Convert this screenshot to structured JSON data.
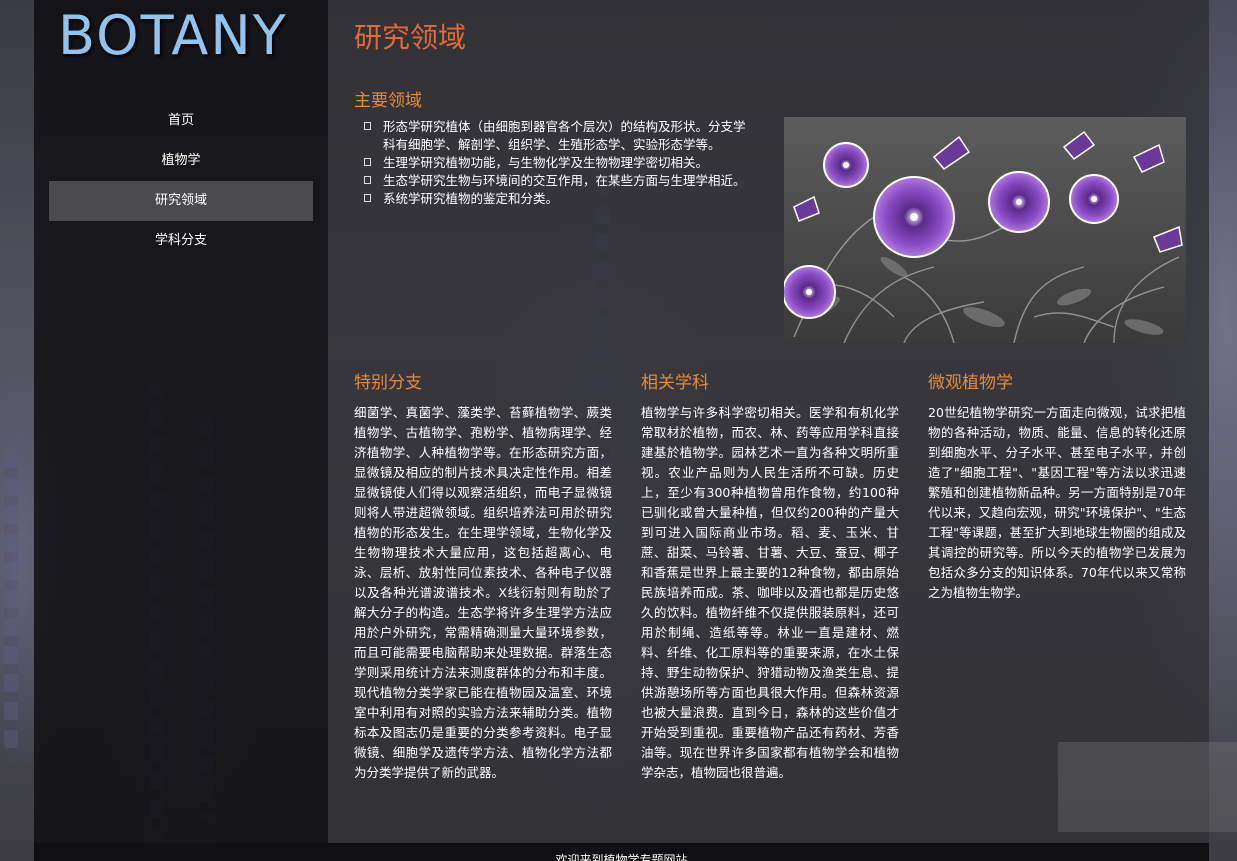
{
  "logo": "BOTANY",
  "nav": {
    "items": [
      {
        "label": "首页"
      },
      {
        "label": "植物学"
      },
      {
        "label": "研究领域"
      },
      {
        "label": "学科分支"
      }
    ],
    "active_index": 2
  },
  "page": {
    "title": "研究领域",
    "main_section": {
      "heading": "主要领域",
      "items": [
        "形态学研究植体（由细胞到器官各个层次）的结构及形状。分支学科有细胞学、解剖学、组织学、生殖形态学、实验形态学等。",
        "生理学研究植物功能，与生物化学及生物物理学密切相关。",
        "生态学研究生物与环境间的交互作用，在某些方面与生理学相近。",
        "系统学研究植物的鉴定和分类。"
      ]
    },
    "columns": [
      {
        "heading": "特别分支",
        "text": "细菌学、真菌学、藻类学、苔藓植物学、蕨类植物学、古植物学、孢粉学、植物病理学、经济植物学、人种植物学等。在形态研究方面，显微镜及相应的制片技术具决定性作用。相差显微镜使人们得以观察活组织，而电子显微镜则将人带进超微领域。组织培养法可用於研究植物的形态发生。在生理学领域，生物化学及生物物理技术大量应用，这包括超离心、电泳、层析、放射性同位素技术、各种电子仪器以及各种光谱波谱技术。X线衍射则有助於了解大分子的构造。生态学将许多生理学方法应用於户外研究，常需精确测量大量环境参数，而且可能需要电脑帮助来处理数据。群落生态学则采用统计方法来测度群体的分布和丰度。现代植物分类学家已能在植物园及温室、环境室中利用有对照的实验方法来辅助分类。植物标本及图志仍是重要的分类参考资料。电子显微镜、细胞学及遗传学方法、植物化学方法都为分类学提供了新的武器。"
      },
      {
        "heading": "相关学科",
        "text": "植物学与许多科学密切相关。医学和有机化学常取材於植物，而农、林、药等应用学科直接建基於植物学。园林艺术一直为各种文明所重视。农业产品则为人民生活所不可缺。历史上，至少有300种植物曾用作食物，约100种已驯化或曾大量种植，但仅约200种的产量大到可进入国际商业市场。稻、麦、玉米、甘蔗、甜菜、马铃薯、甘薯、大豆、蚕豆、椰子和香蕉是世界上最主要的12种食物，都由原始民族培养而成。茶、咖啡以及酒也都是历史悠久的饮料。植物纤维不仅提供服装原料，还可用於制绳、造纸等等。林业一直是建材、燃料、纤维、化工原料等的重要来源，在水土保持、野生动物保护、狩猎动物及渔类生息、提供游憩场所等方面也具很大作用。但森林资源也被大量浪费。直到今日，森林的这些价值才开始受到重视。重要植物产品还有药材、芳香油等。现在世界许多国家都有植物学会和植物学杂志，植物园也很普遍。"
      },
      {
        "heading": "微观植物学",
        "text": "20世纪植物学研究一方面走向微观，试求把植物的各种活动，物质、能量、信息的转化还原到细胞水平、分子水平、甚至电子水平，并创造了\"细胞工程\"、\"基因工程\"等方法以求迅速繁殖和创建植物新品种。另一方面特别是70年代以来，又趋向宏观，研究\"环境保护\"、\"生态工程\"等课题，甚至扩大到地球生物圈的组成及其调控的研究等。所以今天的植物学已发展为包括众多分支的知识体系。70年代以来又常称之为植物生物学。"
      }
    ]
  },
  "footer": "欢迎来到植物学专题网站",
  "colors": {
    "logo": "#8fc3f0",
    "title": "#e06a3a",
    "heading": "#e58a3a",
    "nav_active_bg": "#4b4b4f"
  }
}
